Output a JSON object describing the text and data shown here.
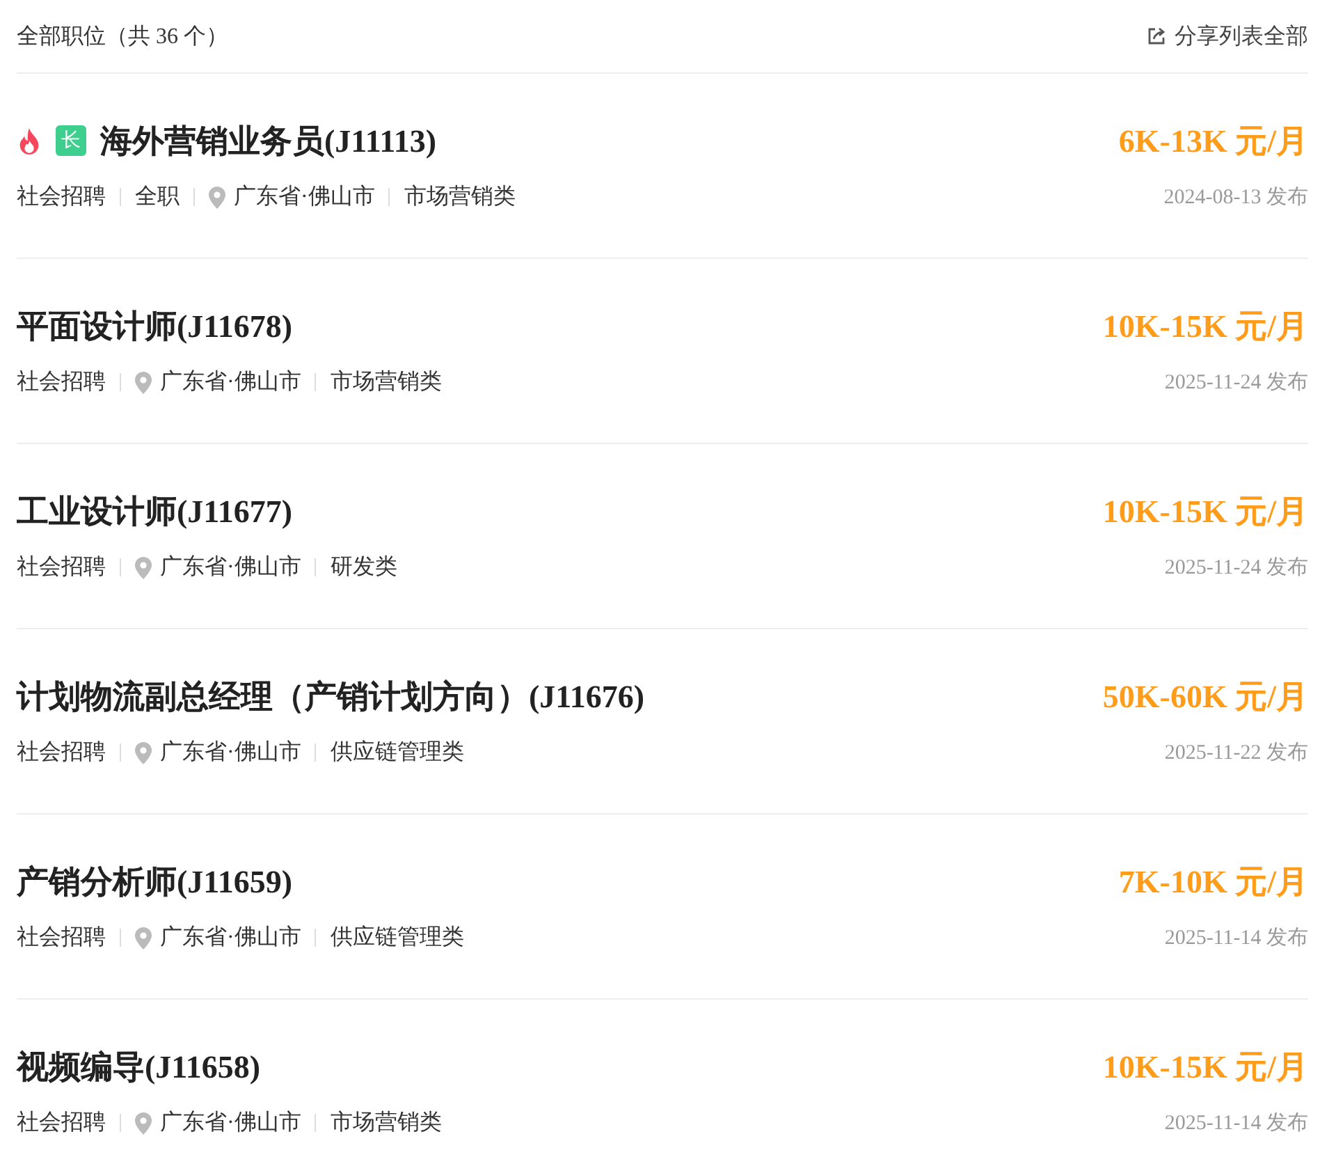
{
  "header": {
    "title": "全部职位（共 36 个）",
    "share": "分享列表全部"
  },
  "jobs": [
    {
      "hot": true,
      "badge": "长",
      "title": "海外营销业务员(J11113)",
      "salary": "6K-13K 元/月",
      "date": "2024-08-13 发布",
      "tags": [
        {
          "kind": "plain",
          "text": "社会招聘"
        },
        {
          "kind": "plain",
          "text": "全职"
        },
        {
          "kind": "location",
          "text": "广东省·佛山市"
        },
        {
          "kind": "plain",
          "text": "市场营销类"
        }
      ]
    },
    {
      "hot": false,
      "title": "平面设计师(J11678)",
      "salary": "10K-15K 元/月",
      "date": "2025-11-24 发布",
      "tags": [
        {
          "kind": "plain",
          "text": "社会招聘"
        },
        {
          "kind": "location",
          "text": "广东省·佛山市"
        },
        {
          "kind": "plain",
          "text": "市场营销类"
        }
      ]
    },
    {
      "hot": false,
      "title": "工业设计师(J11677)",
      "salary": "10K-15K 元/月",
      "date": "2025-11-24 发布",
      "tags": [
        {
          "kind": "plain",
          "text": "社会招聘"
        },
        {
          "kind": "location",
          "text": "广东省·佛山市"
        },
        {
          "kind": "plain",
          "text": "研发类"
        }
      ]
    },
    {
      "hot": false,
      "title": "计划物流副总经理（产销计划方向）(J11676)",
      "salary": "50K-60K 元/月",
      "date": "2025-11-22 发布",
      "tags": [
        {
          "kind": "plain",
          "text": "社会招聘"
        },
        {
          "kind": "location",
          "text": "广东省·佛山市"
        },
        {
          "kind": "plain",
          "text": "供应链管理类"
        }
      ]
    },
    {
      "hot": false,
      "title": "产销分析师(J11659)",
      "salary": "7K-10K 元/月",
      "date": "2025-11-14 发布",
      "tags": [
        {
          "kind": "plain",
          "text": "社会招聘"
        },
        {
          "kind": "location",
          "text": "广东省·佛山市"
        },
        {
          "kind": "plain",
          "text": "供应链管理类"
        }
      ]
    },
    {
      "hot": false,
      "title": "视频编导(J11658)",
      "salary": "10K-15K 元/月",
      "date": "2025-11-14 发布",
      "tags": [
        {
          "kind": "plain",
          "text": "社会招聘"
        },
        {
          "kind": "location",
          "text": "广东省·佛山市"
        },
        {
          "kind": "plain",
          "text": "市场营销类"
        }
      ]
    }
  ]
}
